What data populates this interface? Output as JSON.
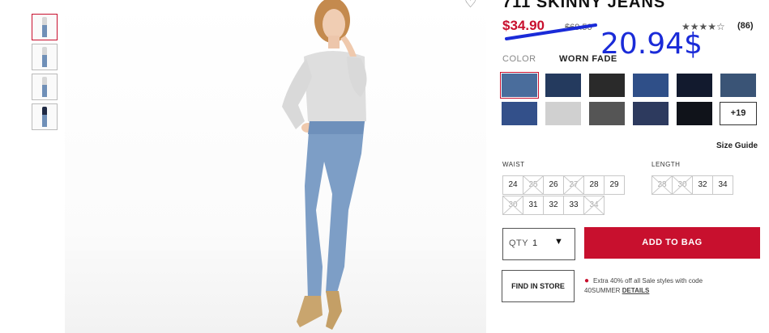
{
  "product": {
    "title": "711 SKINNY JEANS",
    "price": "$34.90",
    "old_price": "$69.50",
    "handwritten_price": "20.94$",
    "stars": "★★★★☆",
    "reviews": "(86)"
  },
  "color": {
    "label": "COLOR",
    "value": "WORN FADE",
    "more_label": "+19",
    "swatches": [
      "#4a6d9c",
      "#243a5e",
      "#2a2a2a",
      "#2f4f88",
      "#121a2e",
      "#3a5476",
      "#33508a",
      "#d0d0d0",
      "#555555",
      "#2d3a5e",
      "#10131a"
    ]
  },
  "size_guide": "Size Guide",
  "waist": {
    "label": "WAIST",
    "sizes": [
      "24",
      "25",
      "26",
      "27",
      "28",
      "29",
      "30",
      "31",
      "32",
      "33",
      "34"
    ]
  },
  "length": {
    "label": "LENGTH",
    "sizes": [
      "28",
      "30",
      "32",
      "34"
    ]
  },
  "qty": {
    "label": "QTY",
    "value": "1",
    "arrow": "▼"
  },
  "buttons": {
    "add_to_bag": "ADD TO BAG",
    "find_in_store": "FIND IN STORE"
  },
  "promo": {
    "text": "Extra 40% off all Sale styles with code",
    "code": "40SUMMER",
    "details": "DETAILS"
  },
  "icons": {
    "wishlist": "heart-icon",
    "promo_bullet": "dot-icon"
  },
  "colors": {
    "accent": "#c8102e",
    "annotation": "#1a2bd8"
  }
}
